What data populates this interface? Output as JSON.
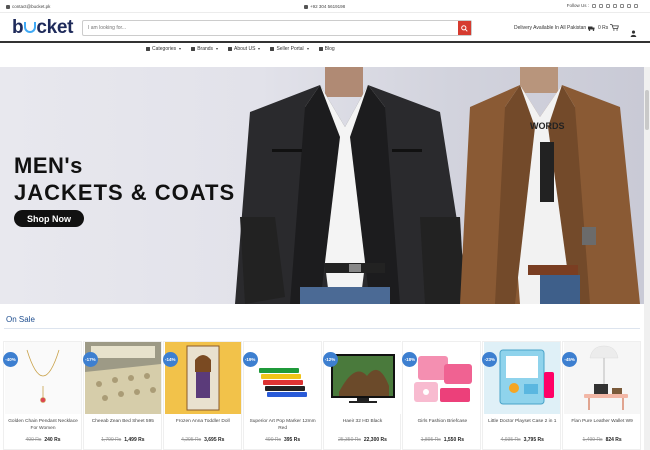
{
  "topbar": {
    "email": "contact@bucket.pk",
    "phone": "+92 304 5619198",
    "follow_label": "Follow Us :"
  },
  "header": {
    "logo_left": "b",
    "logo_right": "cket",
    "search_placeholder": "I am looking for...",
    "delivery": "Delivery Available In All Pakistan",
    "cart": "0 Rs"
  },
  "nav": [
    {
      "label": "Categories",
      "icon": "cart-icon",
      "dropdown": true
    },
    {
      "label": "Brands",
      "icon": "tag-icon",
      "dropdown": true
    },
    {
      "label": "About US",
      "icon": "chat-icon",
      "dropdown": true
    },
    {
      "label": "Seller Portal",
      "icon": "user-icon",
      "dropdown": true
    },
    {
      "label": "Blog",
      "icon": "doc-icon",
      "dropdown": false
    }
  ],
  "banner": {
    "line1": "MEN's",
    "line2": "JACKETS & COATS",
    "cta": "Shop Now",
    "shirt_text": "WORDS"
  },
  "section": {
    "on_sale_title": "On Sale"
  },
  "products": [
    {
      "discount": "-40%",
      "name": "Golden Chain Pendant Necklace For Women",
      "old": "400 Rs",
      "new": "240 Rs"
    },
    {
      "discount": "-17%",
      "name": "Cheeab Zean Bed Sheet 595",
      "old": "1,799 Rs",
      "new": "1,499 Rs"
    },
    {
      "discount": "-14%",
      "name": "Frozen Anna Toddler Doll",
      "old": "4,295 Rs",
      "new": "3,695 Rs"
    },
    {
      "discount": "-19%",
      "name": "Superior Art Pop Marker 12mm Red",
      "old": "490 Rs",
      "new": "395 Rs"
    },
    {
      "discount": "-12%",
      "name": "Haeir 32 HD Black",
      "old": "25,350 Rs",
      "new": "22,300 Rs"
    },
    {
      "discount": "-18%",
      "name": "Girls Fashion Briefcase",
      "old": "1,895 Rs",
      "new": "1,550 Rs"
    },
    {
      "discount": "-23%",
      "name": "Little Doctor Playset Case 2 in 1",
      "old": "4,935 Rs",
      "new": "3,795 Rs"
    },
    {
      "discount": "-45%",
      "name": "Flan Pure Leather Wallet W9",
      "old": "1,499 Rs",
      "new": "824 Rs"
    }
  ],
  "colors": {
    "brand_navy": "#1e2a5a",
    "brand_blue": "#3fa9f5",
    "search_red": "#d63b2f",
    "badge_blue": "#3d7fd0",
    "section_blue": "#1f4e8f"
  }
}
